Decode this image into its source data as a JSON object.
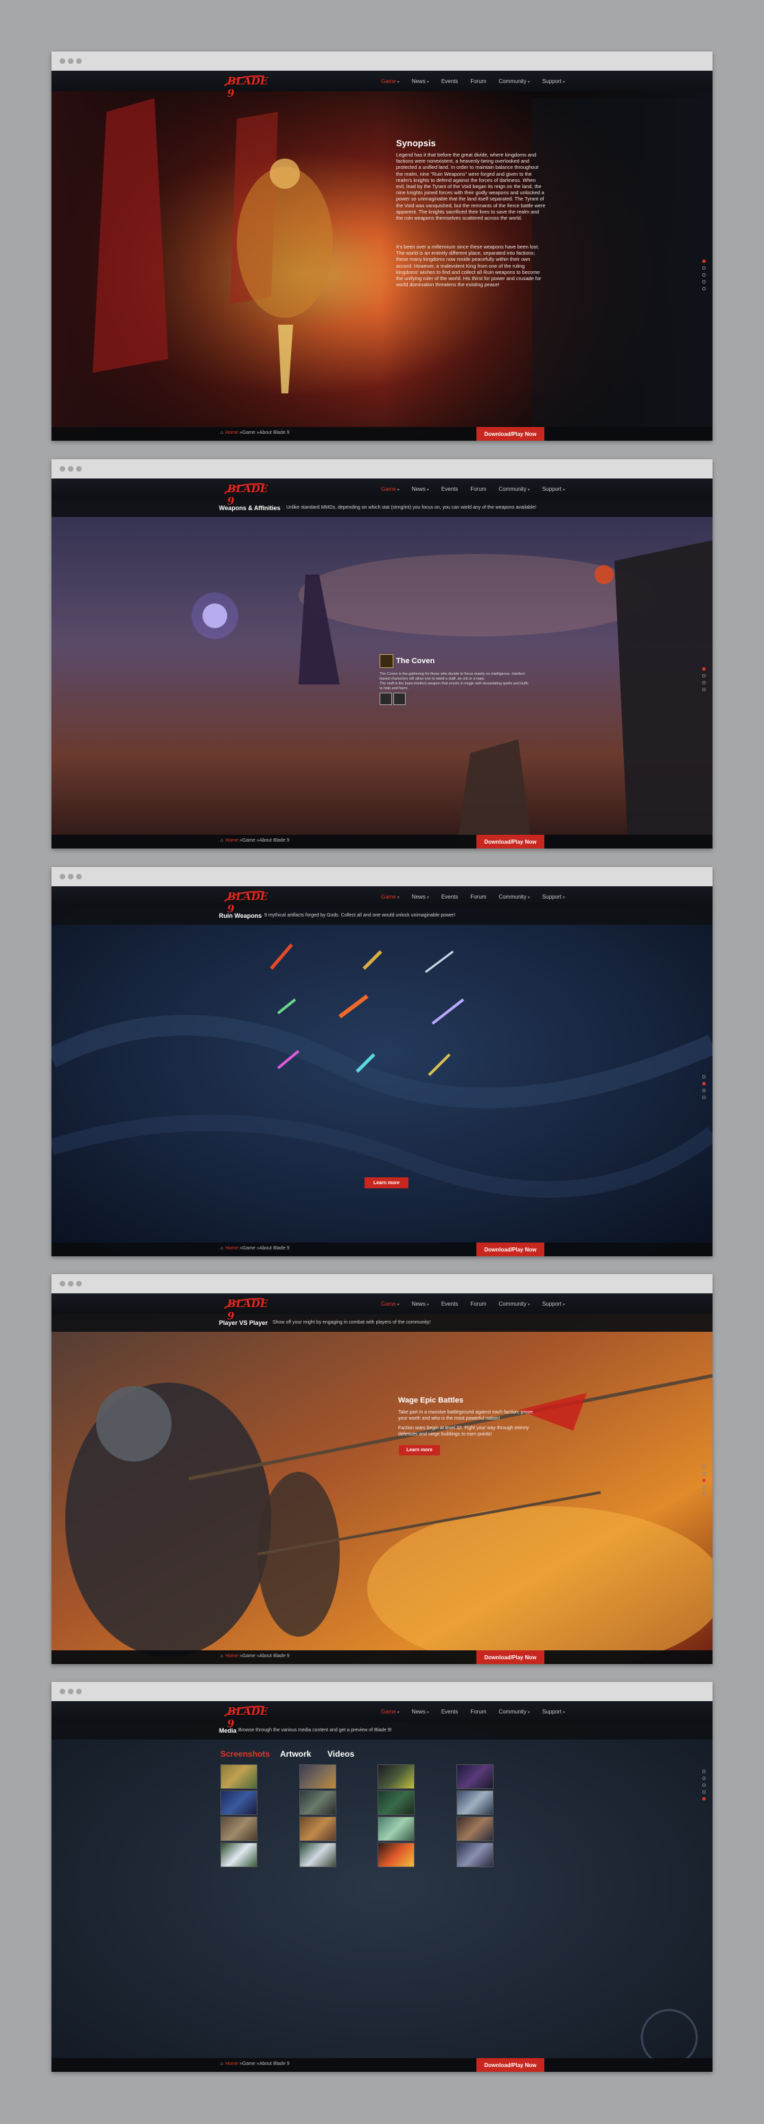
{
  "nav": {
    "logo_text": "BLADE 9",
    "items": [
      {
        "label": "Game",
        "has_caret": true
      },
      {
        "label": "News",
        "has_caret": true
      },
      {
        "label": "Events",
        "has_caret": false
      },
      {
        "label": "Forum",
        "has_caret": false
      },
      {
        "label": "Community",
        "has_caret": true
      },
      {
        "label": "Support",
        "has_caret": true
      }
    ]
  },
  "footer": {
    "crumb_home": "Home",
    "crumb_game": "Game",
    "crumb_page": "About Blade 9",
    "separator": "»",
    "download_label": "Download/Play Now"
  },
  "synopsis": {
    "title": "Synopsis",
    "para1": "Legend has it that before the great divide, where kingdoms and factions were nonexistent, a heavenly-being overlooked and protected a unified land. In order to maintain balance throughout the realm, nine \"Ruin Weapons\" were forged and given to the realm's knights to defend against the forces of darkness. When evil, lead by the Tyrant of the Void began its reign on the land, the nine knights joined forces with their godly weapons and unlocked a power so unimaginable that the land itself separated. The Tyrant of the Void was vanquished, but the remnants of the fierce battle were apparent. The knights sacrificed their lives to save the realm and the ruin weapons themselves scattered across the world.",
    "para2": "It's been over a millennium since these weapons have been lost. The world is an entirely different place, separated into factions; these many kingdoms now reside peacefully within their own accord. However, a malevolent King from one of the ruling kingdoms' wishes to find and collect all Ruin weapons to become the unifying ruler of the world. His thirst for power and crusade for world domination threatens the existing peace!"
  },
  "weapons": {
    "sub_title": "Weapons & Affinities",
    "sub_desc": "Unlike standard MMOs, depending on which stat (strng/int) you focus on, you can wield any of the weapons available!",
    "coven_title": "The Coven",
    "coven_p1": "The Coven is the gathering for those who decide to focus mainly on intelligence. Intellect-based characters will allow one to wield a staff, an orb or a harp.",
    "coven_p2": "The staff is the base-intellect weapon that excels in magic with devastating spells and buffs to help and harm."
  },
  "ruin": {
    "sub_title": "Ruin Weapons",
    "sub_desc": "9 mythical artifacts forged by Gods. Collect all and one would unlock unimaginable power!",
    "learn_more": "Learn more"
  },
  "pvp": {
    "sub_title": "Player VS Player",
    "sub_desc": "Show off your might by engaging in combat with players of the community!",
    "title": "Wage Epic Battles",
    "p1": "Take part in a massive battleground against each faction, prove your worth and who is the most powerful nation!",
    "p2": "Faction wars begin at level 32. Fight your way through enemy defences and siege buildings to earn points!",
    "learn_more": "Learn more"
  },
  "media": {
    "sub_title": "Media",
    "sub_desc": "Browse through the various media content and get a preview of Blade 9!",
    "tabs": [
      "Screenshots",
      "Artwork",
      "Videos"
    ],
    "active_tab": 0
  },
  "colors": {
    "accent": "#c7271e",
    "accent_text": "#e2382b"
  }
}
